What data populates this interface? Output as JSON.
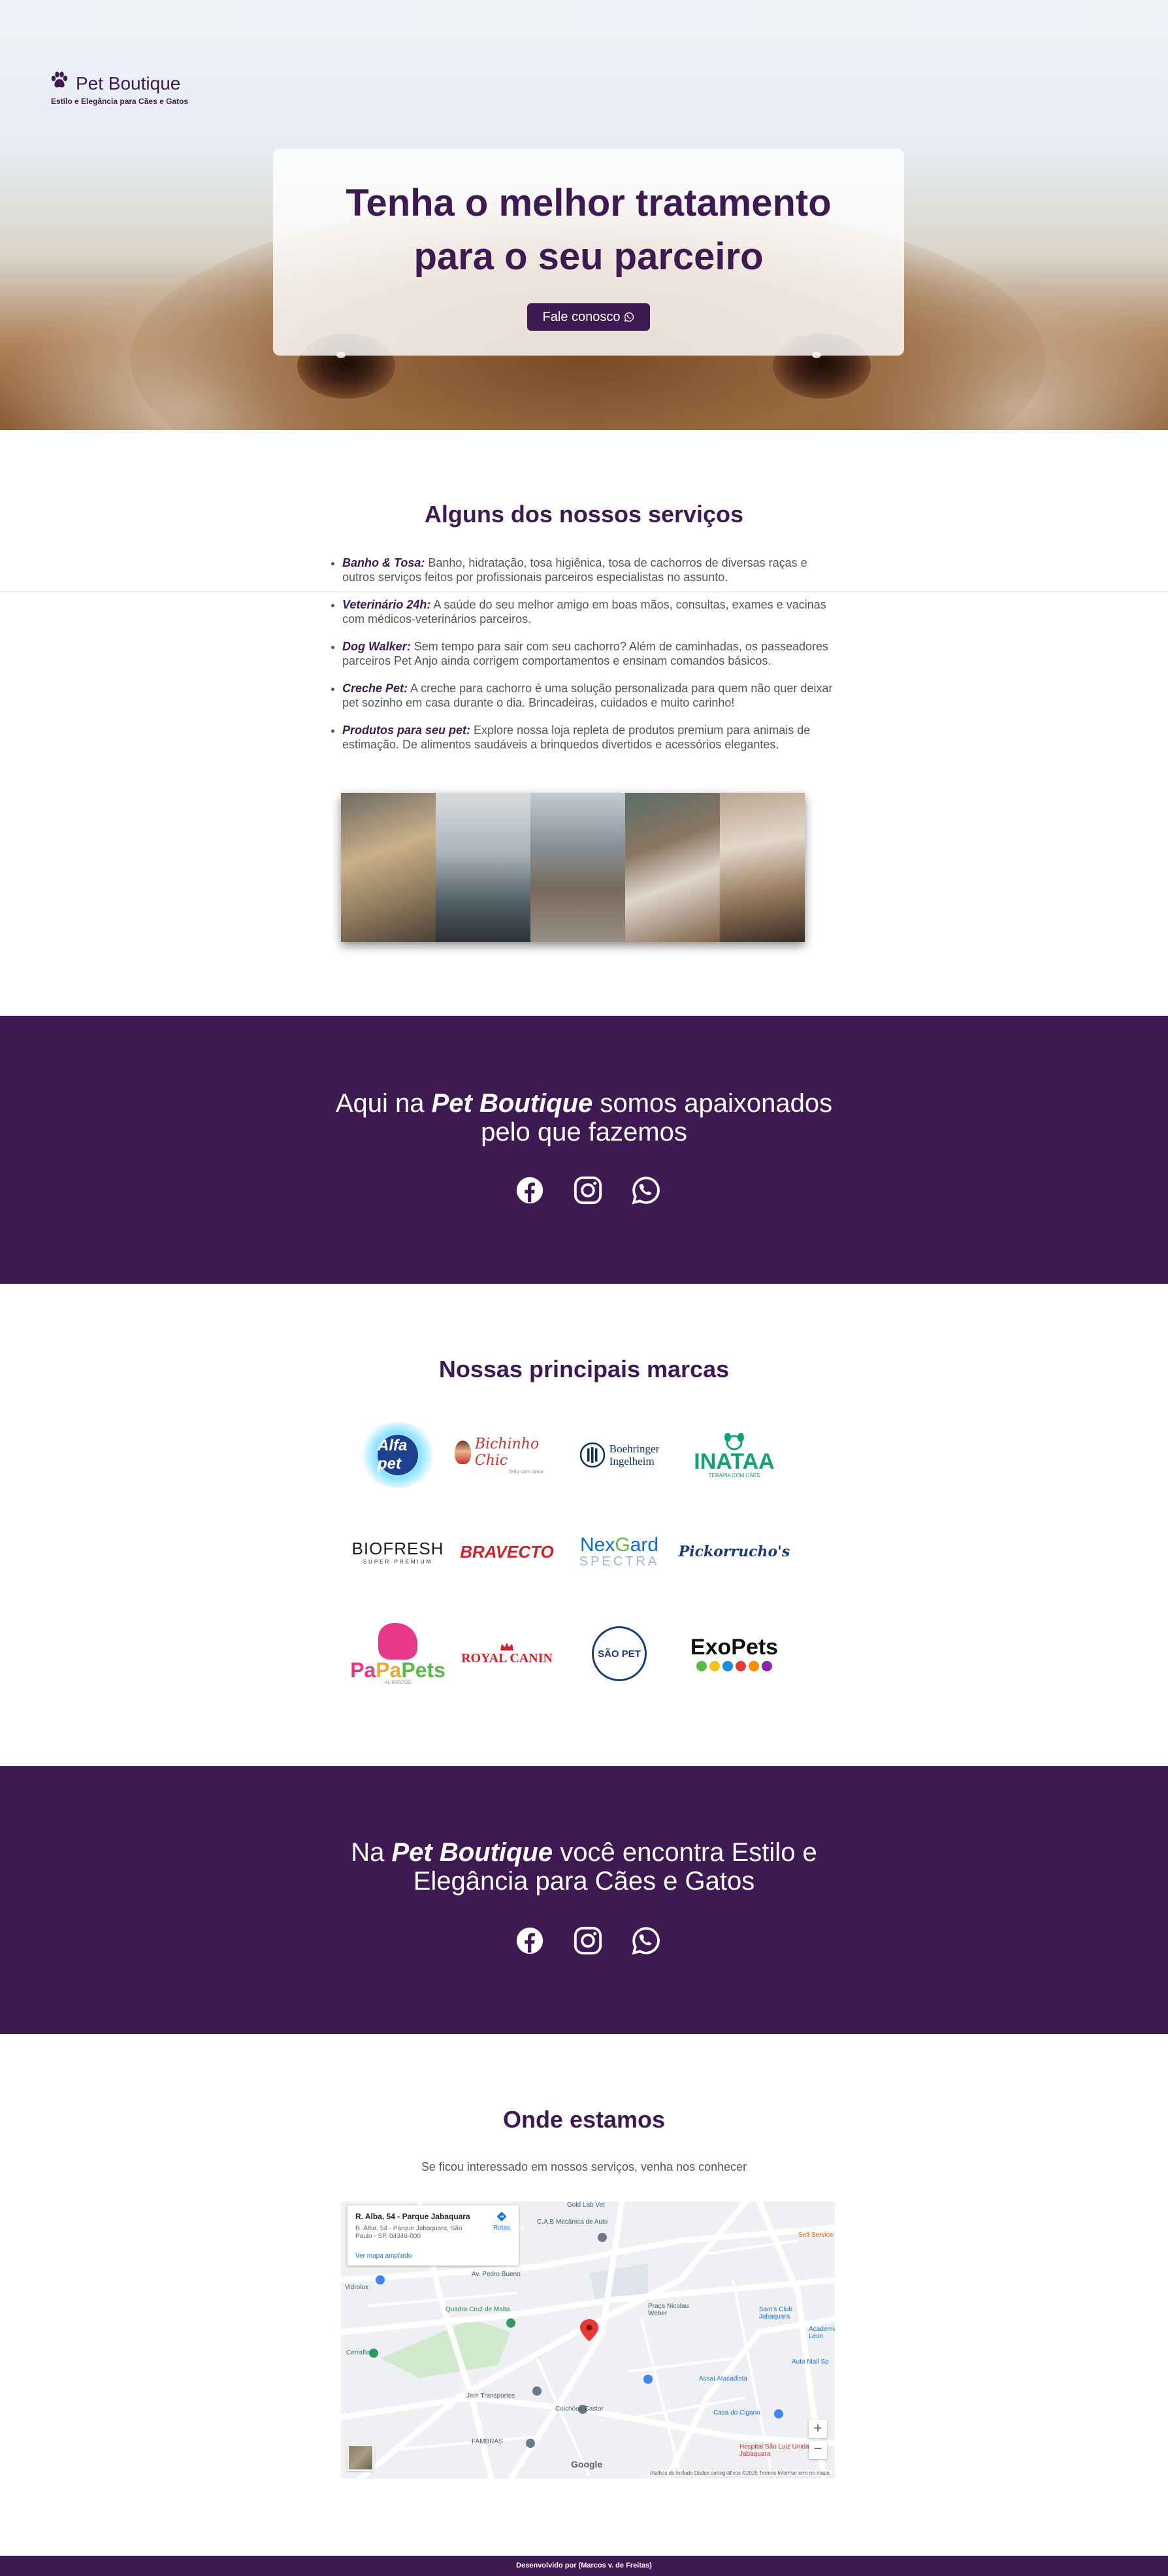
{
  "header": {
    "brand_name": "Pet Boutique",
    "tagline": "Estilo e Elegância para Cães e Gatos"
  },
  "hero": {
    "title_line1": "Tenha o melhor tratamento",
    "title_line2": "para o seu parceiro",
    "cta_label": "Fale conosco"
  },
  "services": {
    "title": "Alguns dos nossos serviços",
    "items": [
      {
        "name": "Banho & Tosa:",
        "text": " Banho, hidratação, tosa higiênica, tosa de cachorros de diversas raças e outros serviços feitos por profissionais parceiros especialistas no assunto."
      },
      {
        "name": "Veterinário 24h:",
        "text": " A saúde do seu melhor amigo em boas mãos, consultas, exames e vacinas com médicos-veterinários parceiros."
      },
      {
        "name": "Dog Walker:",
        "text": " Sem tempo para sair com seu cachorro? Além de caminhadas, os passeadores parceiros Pet Anjo ainda corrigem comportamentos e ensinam comandos básicos."
      },
      {
        "name": "Creche Pet:",
        "text": " A creche para cachorro é uma solução personalizada para quem não quer deixar pet sozinho em casa durante o dia. Brincadeiras, cuidados e muito carinho!"
      },
      {
        "name": "Produtos para seu pet:",
        "text": " Explore nossa loja repleta de produtos premium para animais de estimação. De alimentos saudáveis a brinquedos divertidos e acessórios elegantes."
      }
    ]
  },
  "banner1": {
    "pre": "Aqui na ",
    "brand": "Pet Boutique",
    "post": " somos apaixonados pelo que fazemos"
  },
  "brands": {
    "title": "Nossas principais marcas",
    "items": [
      "Alfa pet",
      "Bichinho Chic",
      "Boehringer Ingelheim",
      "INATAA",
      "BIOFRESH",
      "BRAVECTO",
      "NexGard SPECTRA",
      "Pickorrucho's",
      "PaPa Pets",
      "ROYAL CANIN",
      "SÃO PET",
      "ExoPets"
    ],
    "sublabels": {
      "bichinho": "feito com amor",
      "boehringer": "Ingelheim",
      "inataa": "TERAPIA COM CÃES",
      "biofresh": "SUPER PREMIUM",
      "nexgard": "SPECTRA",
      "papapets": "ALIMENTOS"
    }
  },
  "banner2": {
    "pre": "Na ",
    "brand": "Pet Boutique",
    "post": " você encontra Estilo e Elegância para Cães e Gatos"
  },
  "location": {
    "title": "Onde estamos",
    "subtitle": "Se ficou interessado em nossos serviços, venha nos conhecer",
    "map": {
      "place_name": "R. Alba, 54 - Parque Jabaquara",
      "address": "R. Alba, 54 - Parque Jabaquara, São Paulo - SP, 04346-000",
      "directions_label": "Rotas",
      "larger_map_label": "Ver mapa ampliado",
      "attribution": "Atalhos do teclado   Dados cartográficos ©2025   Termos   Informar erro no mapa",
      "google": "Google",
      "labels": [
        "Av. Pedro Bueno",
        "Quadra Cruz de Malta",
        "Praça Nicolau Weber",
        "Sam's Club Jabaquara",
        "Auto Mall Sp",
        "Assaí Atacadista",
        "Casa do Cigano",
        "Colchões Castor",
        "Hospital São Luiz Unidade Jabaquara",
        "Jem Transportes",
        "FAMBRAS",
        "Vidrolux",
        "Cerraflex",
        "C.A.B Mecânica de Auto",
        "Gold Lab Vet",
        "Self Service",
        "Academia Leon"
      ]
    }
  },
  "footer": {
    "credit": "Desenvolvido por (Marcos v. de Freitas)"
  },
  "colors": {
    "brand_purple": "#3f1a52",
    "text_gray": "#555555"
  },
  "icons": [
    "paw-icon",
    "whatsapp-icon",
    "facebook-icon",
    "instagram-icon"
  ]
}
